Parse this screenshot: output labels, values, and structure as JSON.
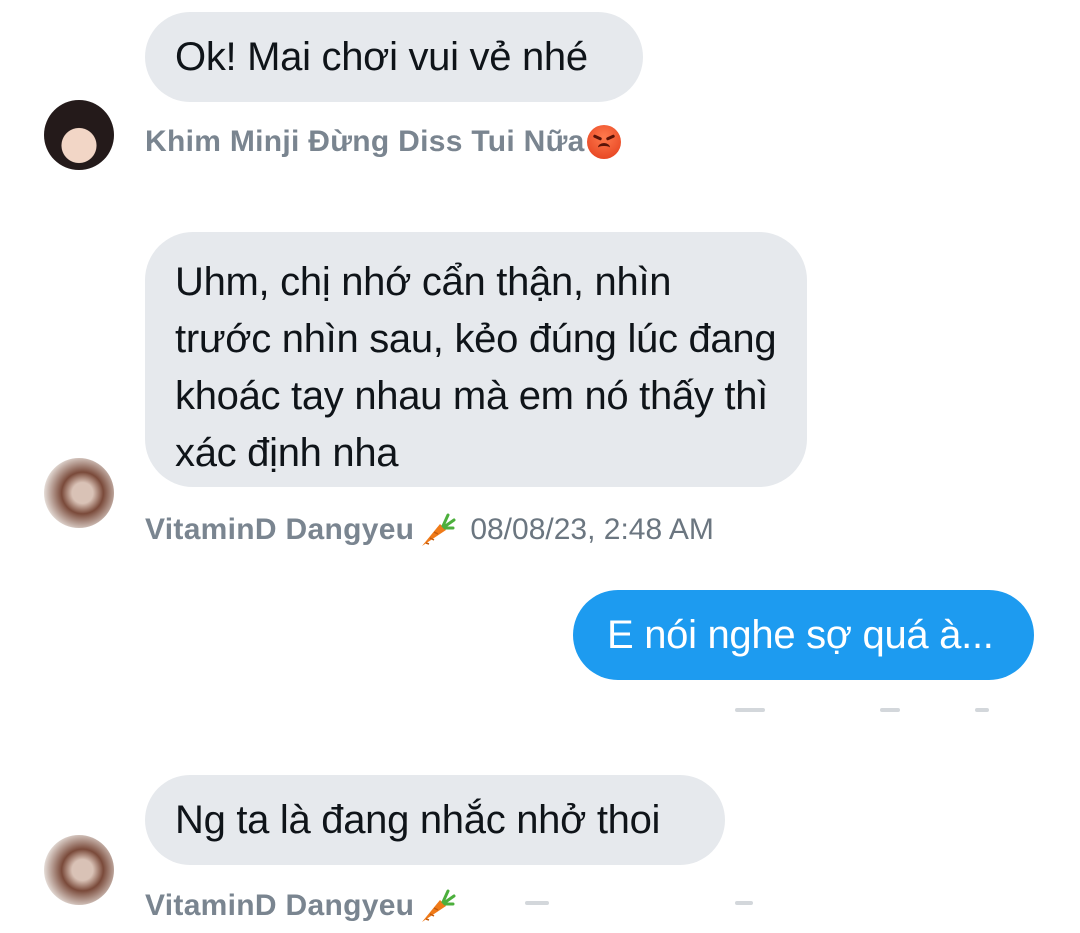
{
  "messages": [
    {
      "text": "Ok! Mai chơi vui vẻ nhé"
    },
    {
      "text": "Uhm, chị nhớ cẩn thận, nhìn trước nhìn sau, kẻo đúng lúc đang khoác tay nhau mà em nó thấy thì xác định nha"
    },
    {
      "text": "E nói nghe sợ quá à..."
    },
    {
      "text": "Ng ta là đang nhắc nhở thoi"
    }
  ],
  "meta": {
    "m1": {
      "sender": "Khim Minji Đừng Diss Tui Nữa",
      "emoji": "angry-face-icon"
    },
    "m2": {
      "sender": "VitaminD Dangyeu",
      "emoji": "carrot-icon",
      "time": "08/08/23, 2:48 AM"
    },
    "m4": {
      "sender": "VitaminD Dangyeu",
      "emoji": "carrot-icon"
    }
  },
  "colors": {
    "incoming_bubble": "#e6e9ed",
    "outgoing_bubble": "#1d9bf0",
    "meta_text": "#7a8590"
  }
}
